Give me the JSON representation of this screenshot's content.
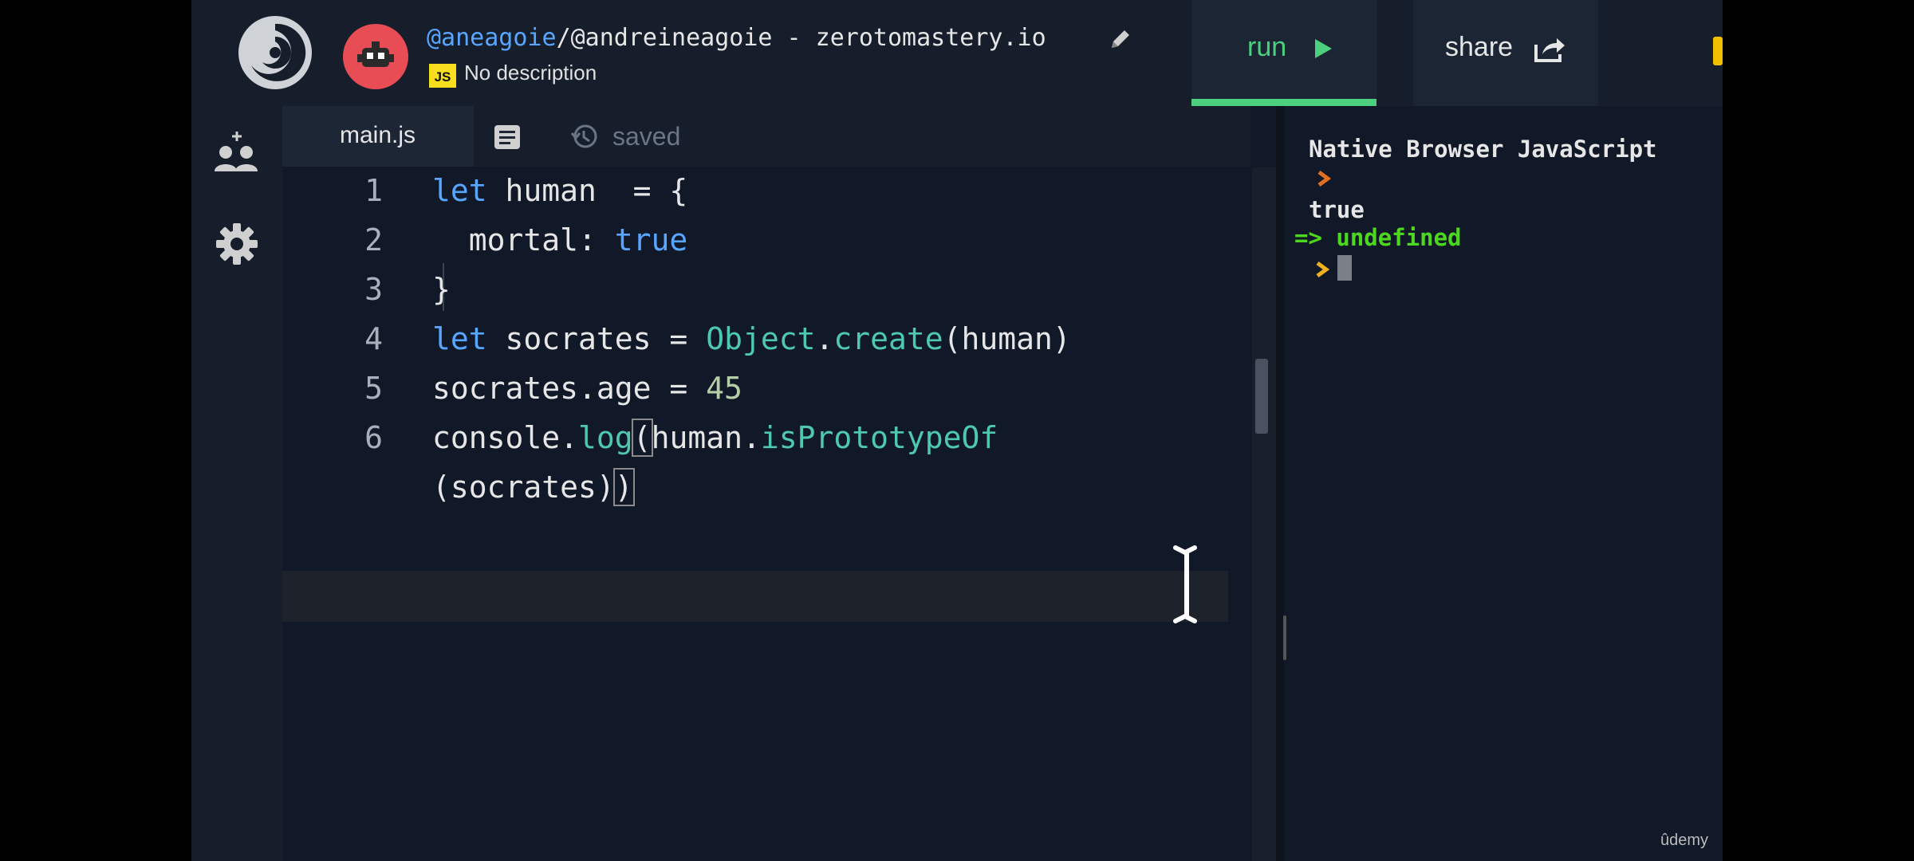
{
  "header": {
    "user_handle": "@aneagoie",
    "repo_rest": "/@andreineagoie - zerotomastery.io",
    "language_badge": "JS",
    "description": "No description",
    "run_label": "run",
    "share_label": "share"
  },
  "editor": {
    "tab_label": "main.js",
    "saved_label": "saved",
    "lines": [
      {
        "num": "1",
        "text": "let human  = {"
      },
      {
        "num": "2",
        "text": "  mortal: true"
      },
      {
        "num": "3",
        "text": "}"
      },
      {
        "num": "4",
        "text": "let socrates = Object.create(human)"
      },
      {
        "num": "5",
        "text": "socrates.age = 45"
      },
      {
        "num": "6",
        "text": "console.log(human.isPrototypeOf"
      },
      {
        "num": "",
        "text": "(socrates))"
      }
    ]
  },
  "console": {
    "header": "Native Browser JavaScript",
    "output_true": "true",
    "output_undefined": "=> undefined"
  },
  "watermark": "ûdemy",
  "colors": {
    "accent_green": "#4cd07d",
    "keyword_blue": "#58a6ff",
    "class_teal": "#4ec9b0",
    "console_green": "#4cd81e",
    "prompt_orange": "#e07020"
  },
  "icons": [
    "replit-logo-icon",
    "avatar-robot-icon",
    "pencil-icon",
    "play-icon",
    "share-icon",
    "multiplayer-icon",
    "settings-icon",
    "document-icon",
    "history-icon",
    "text-cursor-icon"
  ]
}
